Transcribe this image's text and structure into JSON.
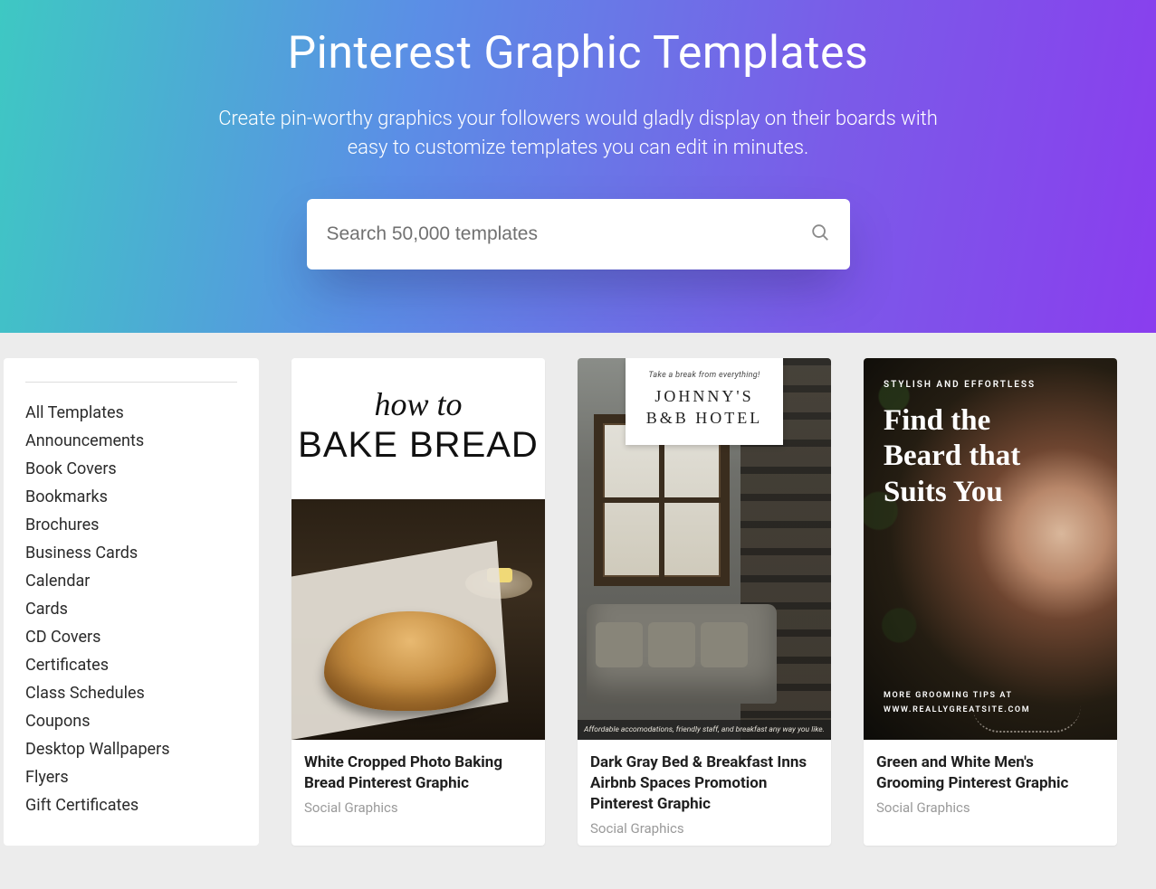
{
  "hero": {
    "title": "Pinterest Graphic Templates",
    "subtitle": "Create pin-worthy graphics your followers would gladly display on their boards with easy to customize templates you can edit in minutes."
  },
  "search": {
    "placeholder": "Search 50,000 templates"
  },
  "sidebar": {
    "items": [
      "All Templates",
      "Announcements",
      "Book Covers",
      "Bookmarks",
      "Brochures",
      "Business Cards",
      "Calendar",
      "Cards",
      "CD Covers",
      "Certificates",
      "Class Schedules",
      "Coupons",
      "Desktop Wallpapers",
      "Flyers",
      "Gift Certificates"
    ]
  },
  "cards": [
    {
      "title": "White Cropped Photo Baking Bread Pinterest Graphic",
      "category": "Social Graphics",
      "art": {
        "line1": "how to",
        "line2": "BAKE BREAD"
      }
    },
    {
      "title": "Dark Gray Bed & Breakfast Inns Airbnb Spaces Promotion Pinterest Graphic",
      "category": "Social Graphics",
      "art": {
        "tagline": "Take a break from everything!",
        "name_l1": "JOHNNY'S",
        "name_l2": "B&B HOTEL",
        "footer": "Affordable accomodations, friendly staff, and breakfast any way you like."
      }
    },
    {
      "title": "Green and White Men's Grooming Pinterest Graphic",
      "category": "Social Graphics",
      "art": {
        "overline": "STYLISH AND EFFORTLESS",
        "headline": "Find the Beard that Suits You",
        "foot1": "MORE GROOMING TIPS AT",
        "foot2": "WWW.REALLYGREATSITE.COM"
      }
    }
  ]
}
